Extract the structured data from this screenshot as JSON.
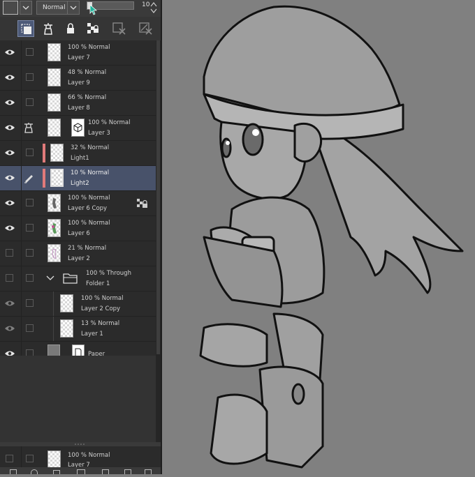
{
  "toolbar": {
    "blend_mode": "Normal",
    "opacity_value": "10",
    "opacity_fraction": 0.1
  },
  "icons": {
    "toolbar": [
      "clip-to-layer-below-icon",
      "reference-layer-icon",
      "lock-icon",
      "lock-transparent-icon",
      "draft-layer-icon",
      "mask-icon"
    ],
    "row": [
      "eye-icon",
      "reference-layer-icon",
      "pen-icon",
      "lock-transparent-icon",
      "folder-icon",
      "chevron-down-icon"
    ]
  },
  "colors": {
    "selected_row": "#48526a",
    "layer_color_tag": "#e07a7a",
    "canvas_background": "#808080"
  },
  "layers": [
    {
      "line1": "100 % Normal",
      "line2": "Layer 7",
      "visible": true
    },
    {
      "line1": "48 % Normal",
      "line2": "Layer 9",
      "visible": true
    },
    {
      "line1": "66 % Normal",
      "line2": "Layer 8",
      "visible": true
    },
    {
      "line1": "100 % Normal",
      "line2": "Layer 3",
      "visible": true
    },
    {
      "line1": "32 % Normal",
      "line2": "Light1",
      "visible": true
    },
    {
      "line1": "10 % Normal",
      "line2": "Light2",
      "visible": true,
      "selected": true
    },
    {
      "line1": "100 % Normal",
      "line2": "Layer 6 Copy",
      "visible": true
    },
    {
      "line1": "100 % Normal",
      "line2": "Layer 6",
      "visible": true
    },
    {
      "line1": "21 % Normal",
      "line2": "Layer 2",
      "visible": false
    },
    {
      "line1": "100 % Through",
      "line2": "Folder 1",
      "visible": false
    },
    {
      "line1": "100 % Normal",
      "line2": "Layer 2 Copy",
      "visible": false
    },
    {
      "line1": "13 % Normal",
      "line2": "Layer 1",
      "visible": false
    },
    {
      "line1": "",
      "line2": "Paper",
      "visible": true
    }
  ],
  "bottom_layer": {
    "line1": "100 % Normal",
    "line2": "Layer 7"
  }
}
